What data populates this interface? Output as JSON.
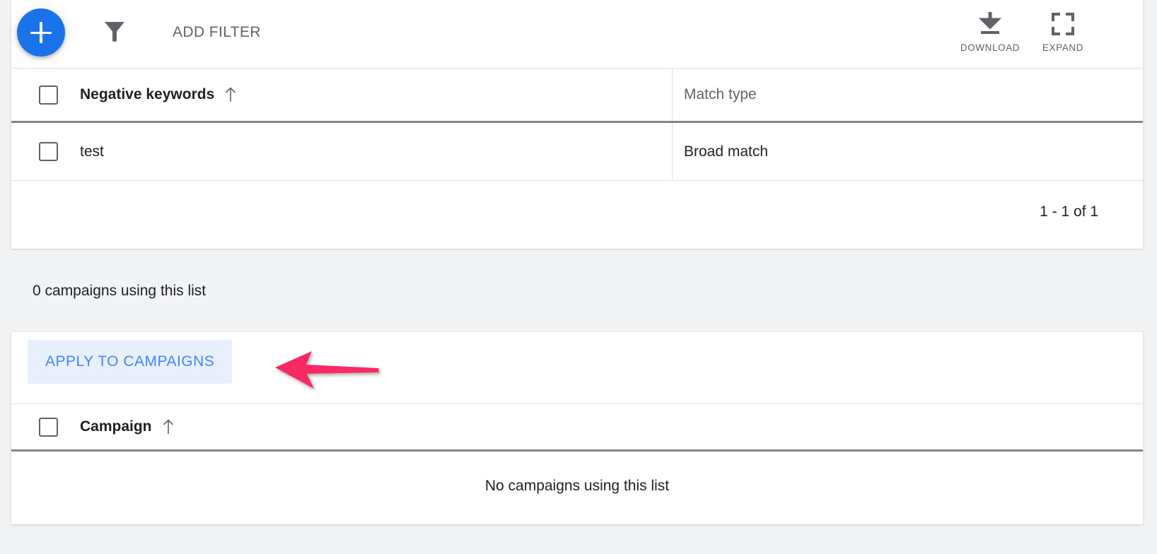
{
  "toolbar": {
    "add_button_icon": "plus-icon",
    "filter_icon": "funnel-icon",
    "add_filter_label": "ADD FILTER",
    "download": {
      "icon": "download-icon",
      "label": "DOWNLOAD"
    },
    "expand": {
      "icon": "expand-icon",
      "label": "EXPAND"
    }
  },
  "keywords_table": {
    "columns": [
      {
        "label": "Negative keywords",
        "sort": "ascending"
      },
      {
        "label": "Match type",
        "sort": "none"
      }
    ],
    "rows": [
      {
        "keyword": "test",
        "match_type": "Broad match"
      }
    ],
    "pagination": "1 - 1 of 1"
  },
  "usage_band": {
    "text": "0 campaigns using this list"
  },
  "campaigns_section": {
    "apply_button_label": "APPLY TO CAMPAIGNS",
    "columns": [
      {
        "label": "Campaign",
        "sort": "ascending"
      }
    ],
    "empty_message": "No campaigns using this list"
  },
  "annotation": {
    "type": "arrow",
    "direction": "left",
    "color": "#F72A63",
    "points_at": "APPLY TO CAMPAIGNS"
  },
  "colors": {
    "accent_blue": "#1A73E8",
    "button_blue_text": "#4285F4",
    "button_blue_bg": "#E8F0FE",
    "page_background": "#F1F3F4",
    "card_background": "#FFFFFF",
    "text_primary": "#202124",
    "text_secondary": "#5F6368",
    "divider": "#E0E0E0",
    "divider_strong": "#80868B",
    "annotation_pink": "#F72A63"
  }
}
